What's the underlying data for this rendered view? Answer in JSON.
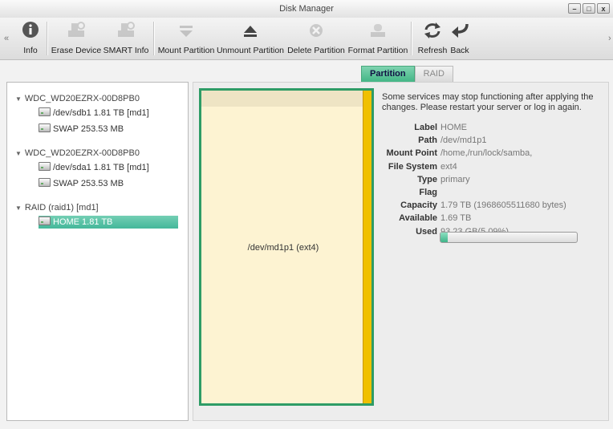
{
  "window": {
    "title": "Disk Manager"
  },
  "toolbar": {
    "items": [
      {
        "label": "Info",
        "icon": "info-icon"
      },
      {
        "label": "Erase Device",
        "icon": "erase-device-icon"
      },
      {
        "label": "SMART Info",
        "icon": "smart-info-icon"
      },
      {
        "label": "Mount Partition",
        "icon": "mount-icon"
      },
      {
        "label": "Unmount Partition",
        "icon": "eject-icon"
      },
      {
        "label": "Delete Partition",
        "icon": "delete-icon"
      },
      {
        "label": "Format Partition",
        "icon": "format-icon"
      },
      {
        "label": "Refresh",
        "icon": "refresh-icon"
      },
      {
        "label": "Back",
        "icon": "back-icon"
      }
    ]
  },
  "tabs": [
    {
      "label": "Partition",
      "active": true
    },
    {
      "label": "RAID",
      "active": false
    }
  ],
  "tree": {
    "groups": [
      {
        "name": "WDC_WD20EZRX-00D8PB0",
        "items": [
          "/dev/sdb1 1.81 TB [md1]",
          "SWAP 253.53 MB"
        ]
      },
      {
        "name": "WDC_WD20EZRX-00D8PB0",
        "items": [
          "/dev/sda1 1.81 TB [md1]",
          "SWAP 253.53 MB"
        ]
      },
      {
        "name": "RAID (raid1) [md1]",
        "items": [
          "HOME 1.81 TB"
        ]
      }
    ],
    "selected": "HOME 1.81 TB"
  },
  "partition_map": {
    "label": "/dev/md1p1 (ext4)"
  },
  "details": {
    "notice": "Some services may stop functioning after applying the changes. Please restart your server or log in again.",
    "fields": [
      {
        "key": "Label",
        "value": "HOME"
      },
      {
        "key": "Path",
        "value": "/dev/md1p1"
      },
      {
        "key": "Mount Point",
        "value": "/home,/run/lock/samba,"
      },
      {
        "key": "File System",
        "value": "ext4"
      },
      {
        "key": "Type",
        "value": "primary"
      },
      {
        "key": "Flag",
        "value": ""
      },
      {
        "key": "Capacity",
        "value": "1.79 TB (1968605511680 bytes)"
      },
      {
        "key": "Available",
        "value": "1.69 TB"
      },
      {
        "key": "Used",
        "value": "93.23 GB(5.09%)"
      }
    ],
    "used_percent": 5.09
  },
  "colors": {
    "accent": "#43b686",
    "used_bar": "#f0c000",
    "partition_fill": "#fdf3d2"
  }
}
